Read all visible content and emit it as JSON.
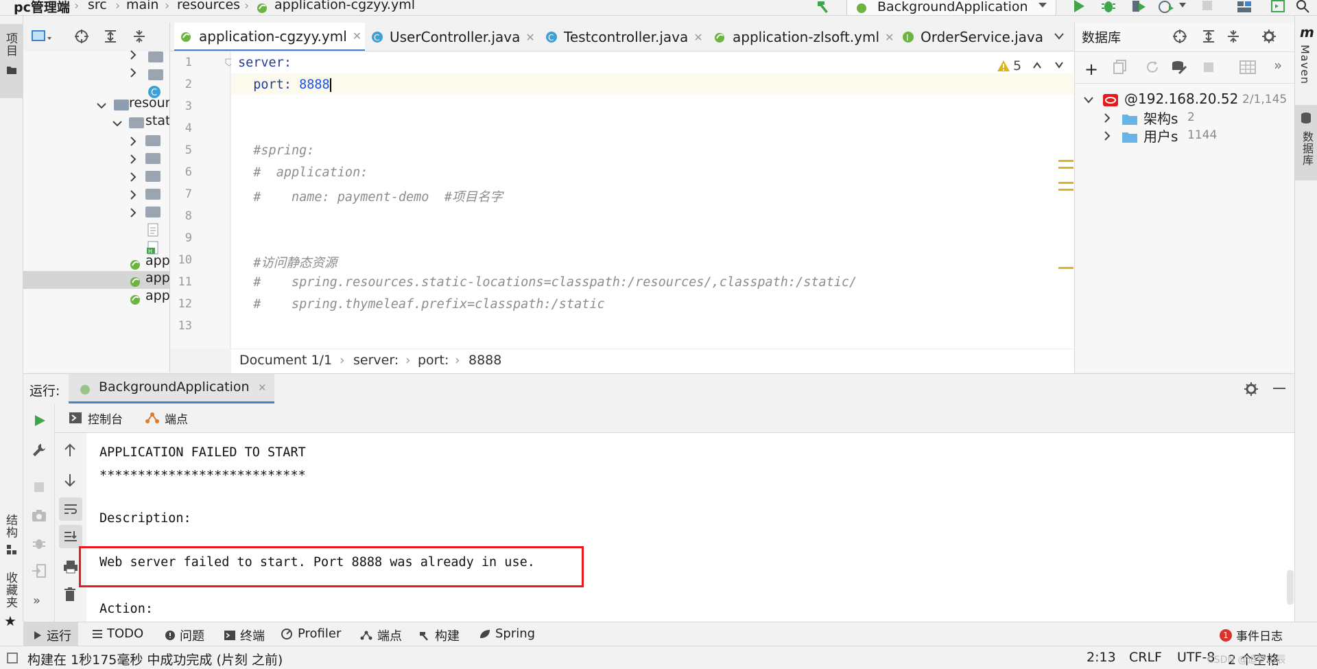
{
  "breadcrumb": {
    "project": "pc管理端",
    "items": [
      "src",
      "main",
      "resources",
      "application-cgzyy.yml"
    ]
  },
  "run_config": {
    "name": "BackgroundApplication"
  },
  "left_stripe": {
    "project_tab": "项目",
    "structure_tab": "结构",
    "favorites_tab": "收藏夹"
  },
  "right_stripe": {
    "maven_tab": "Maven",
    "database_tab": "数据库"
  },
  "project_tree": {
    "rows": [
      {
        "label": "resour"
      },
      {
        "label": "stat"
      },
      {
        "label": "app"
      },
      {
        "label": "app"
      },
      {
        "label": "app"
      }
    ]
  },
  "editor": {
    "tabs": [
      {
        "label": "application-cgzyy.yml",
        "icon": "yaml-icon"
      },
      {
        "label": "UserController.java",
        "icon": "class-icon"
      },
      {
        "label": "Testcontroller.java",
        "icon": "class-icon"
      },
      {
        "label": "application-zlsoft.yml",
        "icon": "yaml-icon"
      },
      {
        "label": "OrderService.java",
        "icon": "interface-icon"
      }
    ],
    "warnings_count": "5",
    "line_numbers": [
      "1",
      "2",
      "3",
      "4",
      "5",
      "6",
      "7",
      "8",
      "9",
      "10",
      "11",
      "12",
      "13"
    ],
    "code_lines": {
      "l1_key": "server:",
      "l2_key": "  port: ",
      "l2_value": "8888",
      "l5": "  #spring:",
      "l6": "  #  application:",
      "l7": "  #    name: payment-demo  #项目名字",
      "l10": "  #访问静态资源",
      "l11": "  #    spring.resources.static-locations=classpath:/resources/,classpath:/static/",
      "l12": "  #    spring.thymeleaf.prefix=classpath:/static"
    },
    "crumbs": [
      "Document 1/1",
      "server:",
      "port:",
      "8888"
    ]
  },
  "database": {
    "title": "数据库",
    "connection": {
      "label": "@192.168.20.52",
      "count": "2/1,145"
    },
    "schemas": [
      {
        "label": "架构s",
        "count": "2"
      },
      {
        "label": "用户s",
        "count": "1144"
      }
    ]
  },
  "run_panel": {
    "label": "运行:",
    "tab": "BackgroundApplication",
    "sub_tabs": [
      "控制台",
      "端点"
    ],
    "console_lines": {
      "cut": "***************************",
      "l1": "APPLICATION FAILED TO START",
      "l2": "***************************",
      "l3": "Description:",
      "l4": "Web server failed to start. Port 8888 was already in use.",
      "l5": "Action:"
    }
  },
  "bottom_tools": [
    "运行",
    "TODO",
    "问题",
    "终端",
    "Profiler",
    "端点",
    "构建",
    "Spring"
  ],
  "event_log": {
    "count": "1",
    "label": "事件日志"
  },
  "status": {
    "message": "构建在 1秒175毫秒 中成功完成 (片刻 之前)",
    "position": "2:13",
    "line_sep": "CRLF",
    "encoding": "UTF-8",
    "indent": "2 个空格",
    "watermark": "CSDN @追梦山辰"
  },
  "colors": {
    "accent": "#4083c9",
    "run_green": "#3fa54a",
    "error_red": "#e8191c",
    "warning_yellow": "#e0b31b"
  }
}
